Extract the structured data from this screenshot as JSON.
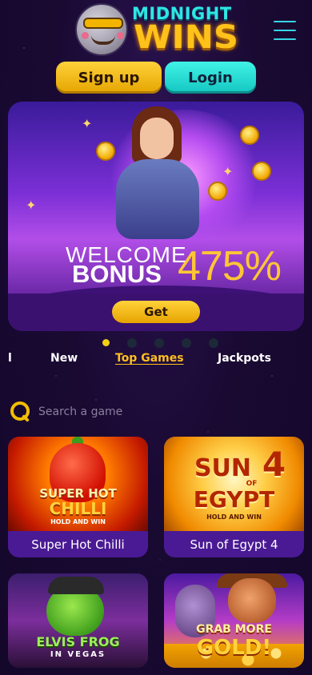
{
  "brand": {
    "line1": "MIDNIGHT",
    "line2": "WINS"
  },
  "auth": {
    "signup_label": "Sign up",
    "login_label": "Login"
  },
  "banner": {
    "welcome": "WELCOME",
    "bonus": "BONUS",
    "percent": "475%",
    "cta_label": "Get",
    "slide_count": 5,
    "active_slide": 1
  },
  "tabs": [
    {
      "label": "l"
    },
    {
      "label": "New"
    },
    {
      "label": "Top Games",
      "active": true
    },
    {
      "label": "Jackpots"
    }
  ],
  "search": {
    "placeholder": "Search a game"
  },
  "games": [
    {
      "title": "Super Hot Chilli",
      "art_line1": "SUPER HOT",
      "art_line2": "CHILLI",
      "art_line3": "HOLD AND WIN"
    },
    {
      "title": "Sun of Egypt 4",
      "art_line1": "SUN",
      "art_line1b": "4",
      "art_line_of": "OF",
      "art_line2": "EGYPT",
      "art_line3": "HOLD AND WIN"
    },
    {
      "title": "",
      "art_line1": "ELVIS FROG",
      "art_line2": "IN VEGAS"
    },
    {
      "title": "",
      "art_line1": "GRAB MORE",
      "art_line2": "GOLD!"
    }
  ],
  "colors": {
    "accent_gold": "#ffbf1f",
    "accent_cyan": "#2ee6e6",
    "card_bg": "#4a1a94",
    "page_bg": "#1a0a33"
  },
  "icons": {
    "menu": "hamburger-icon",
    "search": "search-icon"
  }
}
